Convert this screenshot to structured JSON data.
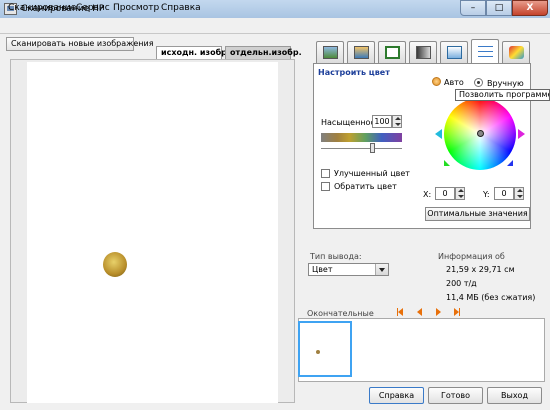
{
  "window": {
    "title": "Сканирование HP",
    "controls": {
      "minimize": "–",
      "maximize": "□",
      "close": "X"
    }
  },
  "menu": [
    "Сканирование",
    "Сервис",
    "Просмотр",
    "Справка"
  ],
  "scan_new_button": "Сканировать новые изображения",
  "preview_tabs": [
    "исходн. изобр.",
    "отдельн.изобр."
  ],
  "tool_tabs": [
    "photo-icon",
    "crop-select-icon",
    "crop-icon",
    "resize-icon",
    "export-icon",
    "color-adjust-icon",
    "tools-icon"
  ],
  "color": {
    "title": "Настроить цвет",
    "auto_label": "Авто",
    "manual_label": "Вручную",
    "tooltip": "Позволить программе",
    "saturation_label": "Насыщенность",
    "saturation_value": "100",
    "enhanced_label": "Улучшенный цвет",
    "invert_label": "Обратить цвет",
    "x_label": "X:",
    "x_value": "0",
    "y_label": "Y:",
    "y_value": "0",
    "optimal_button": "Оптимальные значения"
  },
  "output": {
    "label": "Тип вывода:",
    "selected": "Цвет"
  },
  "info": {
    "label": "Информация об",
    "size": "21,59 x 29,71 см",
    "dpi": "200 т/д",
    "bytes": "11,4 МБ (без сжатия)"
  },
  "final": {
    "label": "Окончательные"
  },
  "buttons": {
    "help": "Справка",
    "done": "Готово",
    "exit": "Выход"
  }
}
